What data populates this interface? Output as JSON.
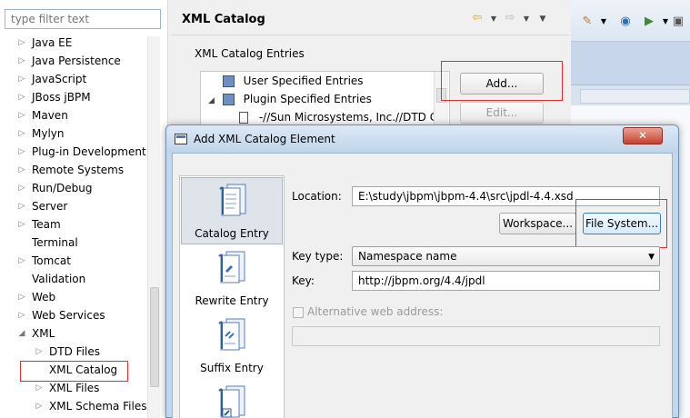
{
  "left_tree": {
    "filter_placeholder": "type filter text",
    "items": [
      {
        "label": "Java EE",
        "expandable": true
      },
      {
        "label": "Java Persistence",
        "expandable": true
      },
      {
        "label": "JavaScript",
        "expandable": true
      },
      {
        "label": "JBoss jBPM",
        "expandable": true
      },
      {
        "label": "Maven",
        "expandable": true
      },
      {
        "label": "Mylyn",
        "expandable": true
      },
      {
        "label": "Plug-in Development",
        "expandable": true
      },
      {
        "label": "Remote Systems",
        "expandable": true
      },
      {
        "label": "Run/Debug",
        "expandable": true
      },
      {
        "label": "Server",
        "expandable": true
      },
      {
        "label": "Team",
        "expandable": true
      },
      {
        "label": "Terminal",
        "expandable": false
      },
      {
        "label": "Tomcat",
        "expandable": true
      },
      {
        "label": "Validation",
        "expandable": false
      },
      {
        "label": "Web",
        "expandable": true
      },
      {
        "label": "Web Services",
        "expandable": true
      },
      {
        "label": "XML",
        "expandable": true,
        "expanded": true
      },
      {
        "label": "DTD Files",
        "expandable": true,
        "child": true
      },
      {
        "label": "XML Catalog",
        "expandable": false,
        "child": true,
        "selected": true
      },
      {
        "label": "XML Files",
        "expandable": true,
        "child": true
      },
      {
        "label": "XML Schema Files",
        "expandable": true,
        "child": true
      }
    ]
  },
  "catalog_page": {
    "title": "XML Catalog",
    "entries_group_label": "XML Catalog Entries",
    "entries": [
      {
        "label": "User Specified Entries",
        "level": 0
      },
      {
        "label": "Plugin Specified Entries",
        "level": 0,
        "expanded": true
      },
      {
        "label": "-//Sun Microsystems, Inc.//DTD C",
        "level": 1
      }
    ],
    "add_button": "Add...",
    "edit_button": "Edit..."
  },
  "dialog": {
    "title": "Add XML Catalog Element",
    "close_label": "✕",
    "side_items": [
      {
        "label": "Catalog Entry",
        "selected": true
      },
      {
        "label": "Rewrite Entry",
        "selected": false
      },
      {
        "label": "Suffix Entry",
        "selected": false
      }
    ],
    "location_label": "Location:",
    "location_value": "E:\\study\\jbpm\\jbpm-4.4\\src\\jpdl-4.4.xsd",
    "workspace_button": "Workspace...",
    "file_system_button": "File System...",
    "key_type_label": "Key type:",
    "key_type_value": "Namespace name",
    "key_label": "Key:",
    "key_value": "http://jbpm.org/4.4/jpdl",
    "alt_address_label": "Alternative web address:"
  },
  "colors": {
    "highlight": "#e03030",
    "dialog_frame": "#c3d7ec",
    "close_button": "#c6402c"
  }
}
